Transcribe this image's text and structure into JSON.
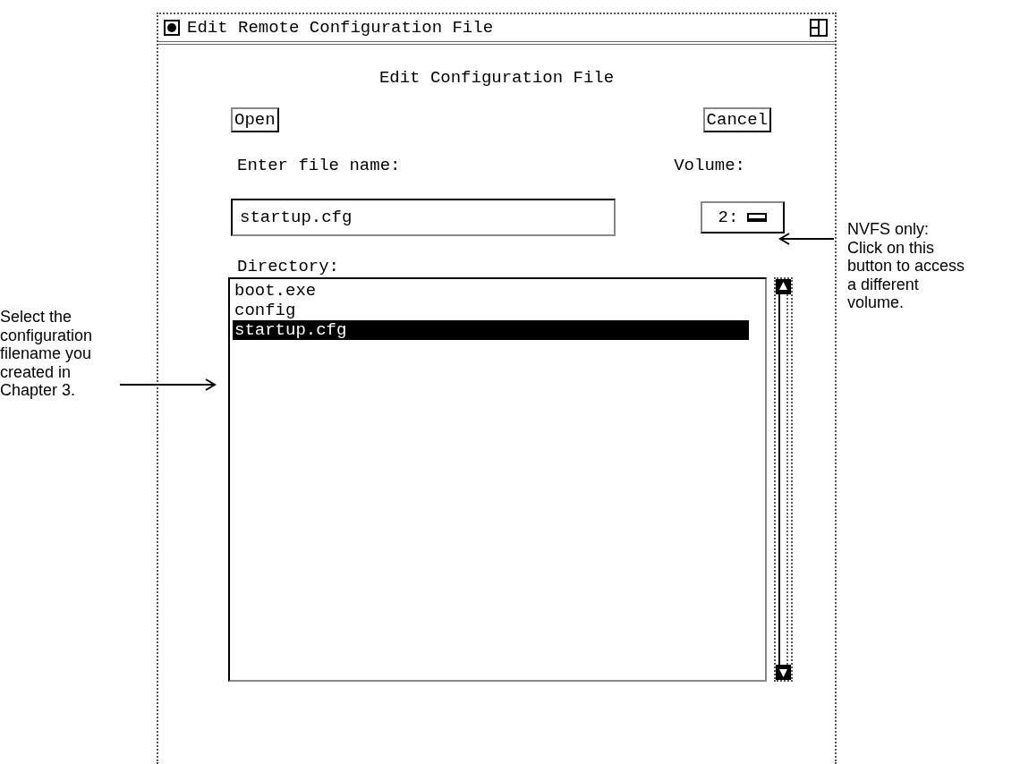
{
  "window": {
    "title": "Edit Remote Configuration File"
  },
  "dialog": {
    "heading": "Edit Configuration File",
    "buttons": [
      {
        "label": "Open"
      },
      {
        "label": "Cancel"
      }
    ],
    "file_name": {
      "label": "Enter file name:",
      "value": "startup.cfg"
    },
    "volume": {
      "label": "Volume:",
      "value": "2:"
    },
    "directory": {
      "label": "Directory:",
      "items": [
        {
          "name": "boot.exe",
          "selected": false
        },
        {
          "name": "config",
          "selected": false
        },
        {
          "name": "startup.cfg",
          "selected": true
        }
      ]
    }
  },
  "callouts": [
    {
      "kind": "left",
      "lines": [
        "Select the",
        "configuration",
        "filename you",
        "created in",
        "Chapter 3."
      ]
    },
    {
      "kind": "right",
      "lines": [
        "NVFS only:",
        "Click on this",
        "button to access",
        "a different",
        "volume."
      ]
    }
  ]
}
